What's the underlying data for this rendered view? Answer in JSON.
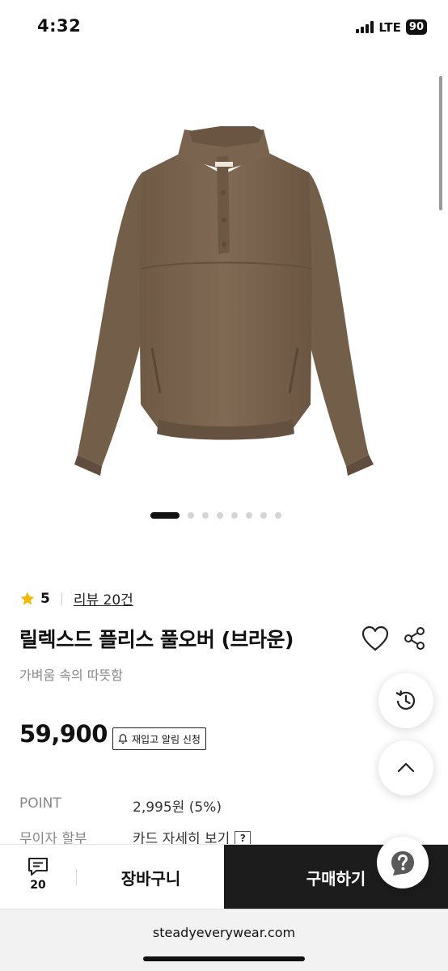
{
  "status_bar": {
    "time": "4:32",
    "network": "LTE",
    "battery": "90"
  },
  "carousel": {
    "total": 8,
    "active_index": 0
  },
  "product": {
    "rating": "5",
    "review_link": "리뷰 20건",
    "title": "릴렉스드 플리스 풀오버 (브라운)",
    "subtitle": "가벼움 속의 따뜻함",
    "price": "59,900",
    "restock_label": "재입고 알림 신청"
  },
  "info": {
    "point_label": "POINT",
    "point_value": "2,995원 (5%)",
    "installment_label": "무이자 할부",
    "installment_value": "카드 자세히 보기",
    "help_mark": "?"
  },
  "bottom_bar": {
    "chat_count": "20",
    "cart_label": "장바구니",
    "buy_label": "구매하기"
  },
  "browser": {
    "url": "steadyeverywear.com"
  },
  "icons": {
    "star": "star-icon",
    "heart": "heart-icon",
    "share": "share-icon",
    "bell": "bell-icon",
    "history": "history-icon",
    "top": "chevron-up-icon",
    "chat": "chat-icon",
    "help": "question-icon"
  },
  "colors": {
    "star": "#F5B800",
    "garment": "#7B6650",
    "buy_button": "#1C1C1C",
    "muted_text": "#888888"
  }
}
